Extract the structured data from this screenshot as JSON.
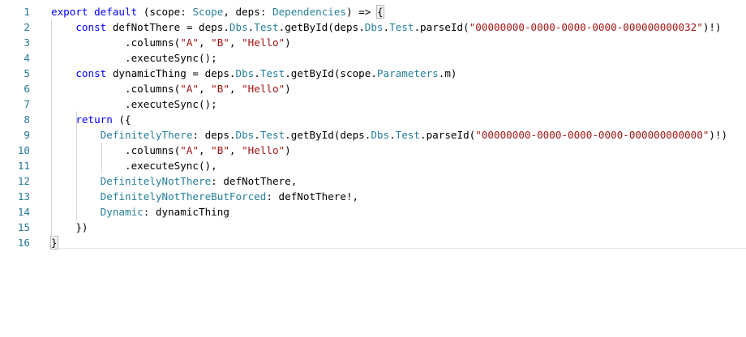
{
  "editor": {
    "line_numbers": [
      "1",
      "2",
      "3",
      "4",
      "5",
      "6",
      "7",
      "8",
      "9",
      "10",
      "11",
      "12",
      "13",
      "14",
      "15",
      "16"
    ],
    "lines": [
      [
        {
          "t": "export",
          "c": "k"
        },
        {
          "t": " "
        },
        {
          "t": "default",
          "c": "k"
        },
        {
          "t": " (scope: "
        },
        {
          "t": "Scope",
          "c": "t"
        },
        {
          "t": ", deps: "
        },
        {
          "t": "Dependencies",
          "c": "t"
        },
        {
          "t": ") => "
        },
        {
          "t": "{",
          "c": "bm"
        }
      ],
      [
        {
          "t": "    "
        },
        {
          "t": "const",
          "c": "k"
        },
        {
          "t": " defNotThere = deps."
        },
        {
          "t": "Dbs",
          "c": "t"
        },
        {
          "t": "."
        },
        {
          "t": "Test",
          "c": "t"
        },
        {
          "t": ".getById(deps."
        },
        {
          "t": "Dbs",
          "c": "t"
        },
        {
          "t": "."
        },
        {
          "t": "Test",
          "c": "t"
        },
        {
          "t": ".parseId("
        },
        {
          "t": "\"00000000-0000-0000-0000-000000000032\"",
          "c": "s"
        },
        {
          "t": ")!)"
        }
      ],
      [
        {
          "t": "            .columns("
        },
        {
          "t": "\"A\"",
          "c": "s"
        },
        {
          "t": ", "
        },
        {
          "t": "\"B\"",
          "c": "s"
        },
        {
          "t": ", "
        },
        {
          "t": "\"Hello\"",
          "c": "s"
        },
        {
          "t": ")"
        }
      ],
      [
        {
          "t": "            .executeSync();"
        }
      ],
      [
        {
          "t": "    "
        },
        {
          "t": "const",
          "c": "k"
        },
        {
          "t": " dynamicThing = deps."
        },
        {
          "t": "Dbs",
          "c": "t"
        },
        {
          "t": "."
        },
        {
          "t": "Test",
          "c": "t"
        },
        {
          "t": ".getById(scope."
        },
        {
          "t": "Parameters",
          "c": "t"
        },
        {
          "t": ".m)"
        }
      ],
      [
        {
          "t": "            .columns("
        },
        {
          "t": "\"A\"",
          "c": "s"
        },
        {
          "t": ", "
        },
        {
          "t": "\"B\"",
          "c": "s"
        },
        {
          "t": ", "
        },
        {
          "t": "\"Hello\"",
          "c": "s"
        },
        {
          "t": ")"
        }
      ],
      [
        {
          "t": "            .executeSync();"
        }
      ],
      [
        {
          "t": "    "
        },
        {
          "t": "return",
          "c": "k"
        },
        {
          "t": " ({"
        }
      ],
      [
        {
          "t": "        "
        },
        {
          "t": "DefinitelyThere",
          "c": "t"
        },
        {
          "t": ": deps."
        },
        {
          "t": "Dbs",
          "c": "t"
        },
        {
          "t": "."
        },
        {
          "t": "Test",
          "c": "t"
        },
        {
          "t": ".getById(deps."
        },
        {
          "t": "Dbs",
          "c": "t"
        },
        {
          "t": "."
        },
        {
          "t": "Test",
          "c": "t"
        },
        {
          "t": ".parseId("
        },
        {
          "t": "\"00000000-0000-0000-0000-000000000000\"",
          "c": "s"
        },
        {
          "t": ")!)"
        }
      ],
      [
        {
          "t": "            .columns("
        },
        {
          "t": "\"A\"",
          "c": "s"
        },
        {
          "t": ", "
        },
        {
          "t": "\"B\"",
          "c": "s"
        },
        {
          "t": ", "
        },
        {
          "t": "\"Hello\"",
          "c": "s"
        },
        {
          "t": ")"
        }
      ],
      [
        {
          "t": "            .executeSync(),"
        }
      ],
      [
        {
          "t": "        "
        },
        {
          "t": "DefinitelyNotThere",
          "c": "t"
        },
        {
          "t": ": defNotThere,"
        }
      ],
      [
        {
          "t": "        "
        },
        {
          "t": "DefinitelyNotThereButForced",
          "c": "t"
        },
        {
          "t": ": defNotThere!,"
        }
      ],
      [
        {
          "t": "        "
        },
        {
          "t": "Dynamic",
          "c": "t"
        },
        {
          "t": ": dynamicThing"
        }
      ],
      [
        {
          "t": "    })"
        }
      ],
      [
        {
          "t": "}",
          "c": "bm"
        }
      ]
    ]
  },
  "colors": {
    "keyword": "#0000ff",
    "type": "#267f99",
    "string": "#a31515",
    "line_number": "#237893",
    "background": "#ffffff"
  }
}
